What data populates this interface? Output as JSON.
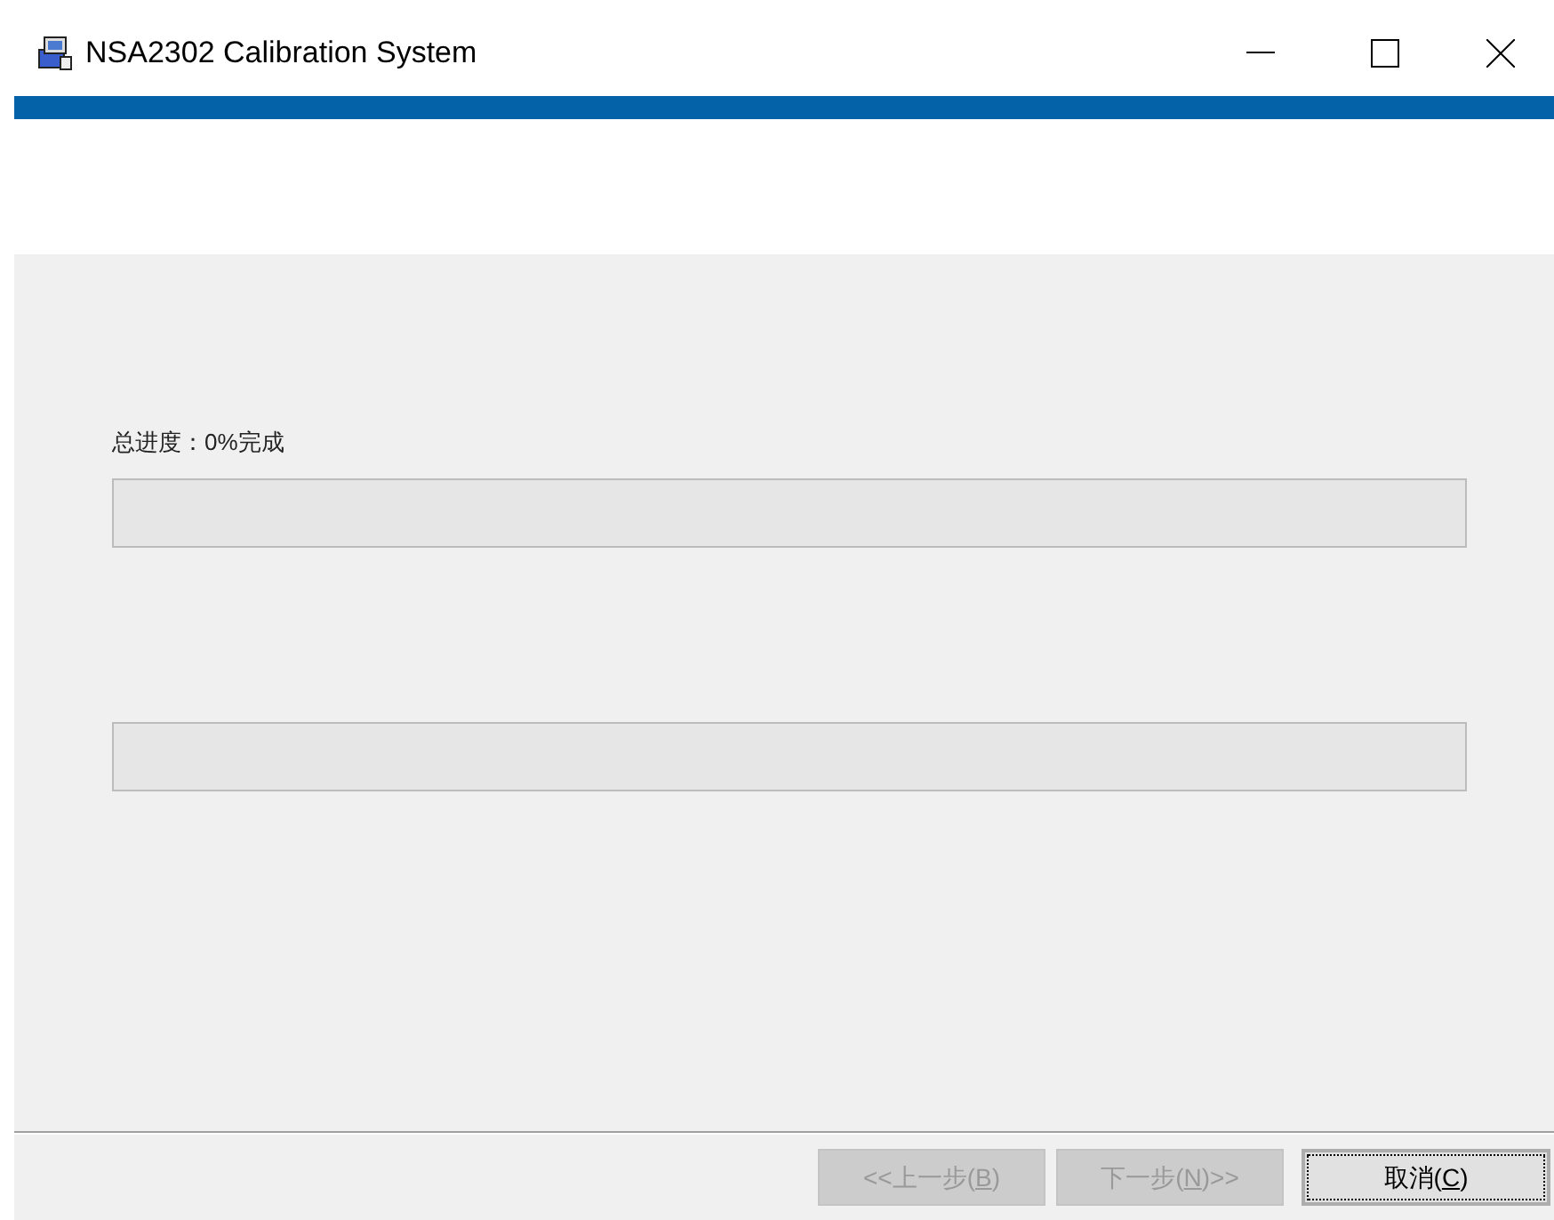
{
  "window": {
    "title": "NSA2302 Calibration System"
  },
  "progress": [
    {
      "label": "总进度：0%完成",
      "level": 0
    },
    {
      "level": 0
    }
  ],
  "buttons": [
    {
      "before": "<<上一步(",
      "key": "B",
      "after": ")",
      "disabled": true,
      "focused": false
    },
    {
      "before": "下一步(",
      "key": "N",
      "after": ")>>",
      "disabled": true,
      "focused": false
    },
    {
      "before": "取消(",
      "key": "C",
      "after": ")",
      "disabled": false,
      "focused": true
    }
  ]
}
